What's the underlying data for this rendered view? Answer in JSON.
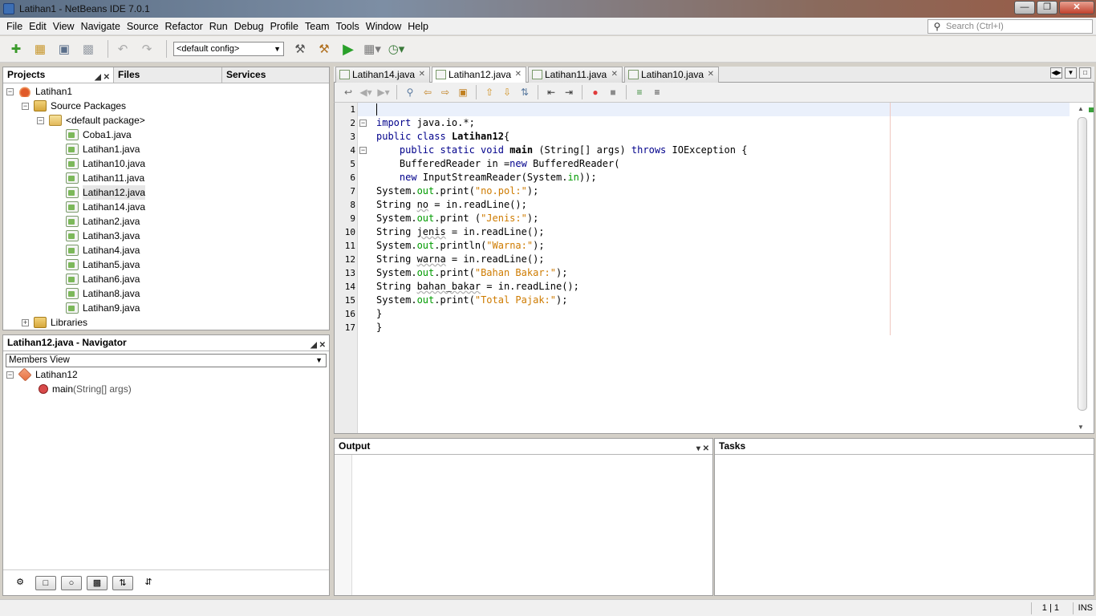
{
  "window": {
    "title": "Latihan1 - NetBeans IDE 7.0.1"
  },
  "menu": [
    "File",
    "Edit",
    "View",
    "Navigate",
    "Source",
    "Refactor",
    "Run",
    "Debug",
    "Profile",
    "Team",
    "Tools",
    "Window",
    "Help"
  ],
  "search": {
    "placeholder": "Search (Ctrl+I)"
  },
  "toolbar": {
    "config_value": "<default config>"
  },
  "projects_panel": {
    "tabs": [
      "Projects",
      "Files",
      "Services"
    ],
    "tree": {
      "project": "Latihan1",
      "source_packages": "Source Packages",
      "default_package": "<default package>",
      "files": [
        "Coba1.java",
        "Latihan1.java",
        "Latihan10.java",
        "Latihan11.java",
        "Latihan12.java",
        "Latihan14.java",
        "Latihan2.java",
        "Latihan3.java",
        "Latihan4.java",
        "Latihan5.java",
        "Latihan6.java",
        "Latihan8.java",
        "Latihan9.java"
      ],
      "selected_file": "Latihan12.java",
      "libraries": "Libraries"
    }
  },
  "navigator": {
    "title": "Latihan12.java - Navigator",
    "view": "Members View",
    "class_name": "Latihan12",
    "method_name": "main",
    "method_params": "(String[] args)"
  },
  "editor": {
    "tabs": [
      "Latihan14.java",
      "Latihan12.java",
      "Latihan11.java",
      "Latihan10.java"
    ],
    "active_tab": "Latihan12.java",
    "lines": [
      "",
      "import java.io.*;",
      "public class Latihan12{",
      "    public static void main (String[] args) throws IOException {",
      "    BufferedReader in =new BufferedReader(",
      "    new InputStreamReader(System.in));",
      "System.out.print(\"no.pol:\");",
      "String no = in.readLine();",
      "System.out.print (\"Jenis:\");",
      "String jenis = in.readLine();",
      "System.out.println(\"Warna:\");",
      "String warna = in.readLine();",
      "System.out.print(\"Bahan Bakar:\");",
      "String bahan_bakar = in.readLine();",
      "System.out.print(\"Total Pajak:\");",
      "}",
      "}"
    ]
  },
  "output_panel": {
    "title": "Output"
  },
  "tasks_panel": {
    "title": "Tasks"
  },
  "status": {
    "position": "1 | 1",
    "mode": "INS"
  }
}
